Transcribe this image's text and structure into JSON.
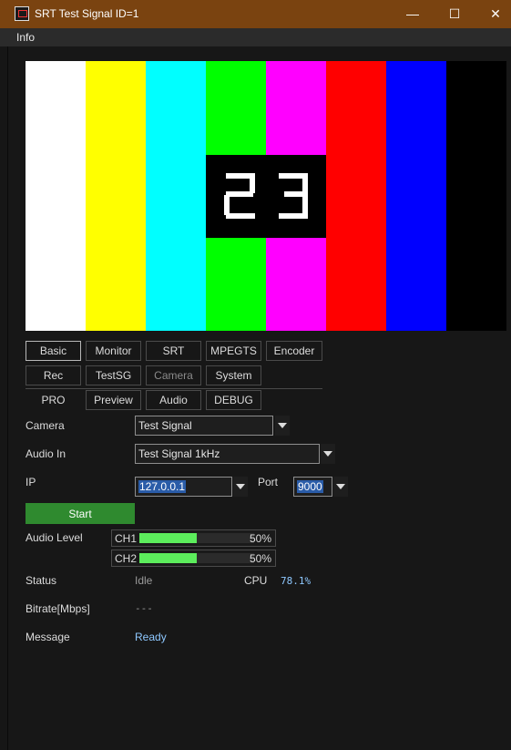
{
  "window": {
    "title": "SRT Test Signal ID=1",
    "controls": {
      "minimize": "—",
      "maximize": "☐",
      "close": "✕"
    }
  },
  "menu": {
    "info": "Info"
  },
  "preview": {
    "counter": "23",
    "bar_colors": [
      "#ffffff",
      "#ffff00",
      "#00ffff",
      "#00ff00",
      "#ff00ff",
      "#ff0000",
      "#0000ff",
      "#000000"
    ]
  },
  "tabs": {
    "row1": [
      "Basic",
      "Monitor",
      "SRT",
      "MPEGTS",
      "Encoder"
    ],
    "row2": [
      "Rec",
      "TestSG",
      "Camera",
      "System"
    ],
    "row3": [
      "PRO",
      "Preview",
      "Audio",
      "DEBUG"
    ]
  },
  "form": {
    "camera_label": "Camera",
    "camera_value": "Test Signal",
    "audio_in_label": "Audio In",
    "audio_in_value": "Test Signal 1kHz",
    "ip_label": "IP",
    "ip_value": "127.0.0.1",
    "port_label": "Port",
    "port_value": "9000",
    "start_label": "Start"
  },
  "audio_level": {
    "label": "Audio Level",
    "channels": [
      {
        "name": "CH1",
        "level": 0.5,
        "text": "50%"
      },
      {
        "name": "CH2",
        "level": 0.5,
        "text": "50%"
      }
    ]
  },
  "status": {
    "status_label": "Status",
    "status_value": "Idle",
    "cpu_label": "CPU",
    "cpu_value": "78.1%",
    "bitrate_label": "Bitrate[Mbps]",
    "bitrate_value": "---",
    "message_label": "Message",
    "message_value": "Ready"
  },
  "colors": {
    "accent_green": "#2f8a2f",
    "meter_green": "#5ced5c",
    "value_blue": "#8ec8ff",
    "titlebar": "#7a4310"
  }
}
